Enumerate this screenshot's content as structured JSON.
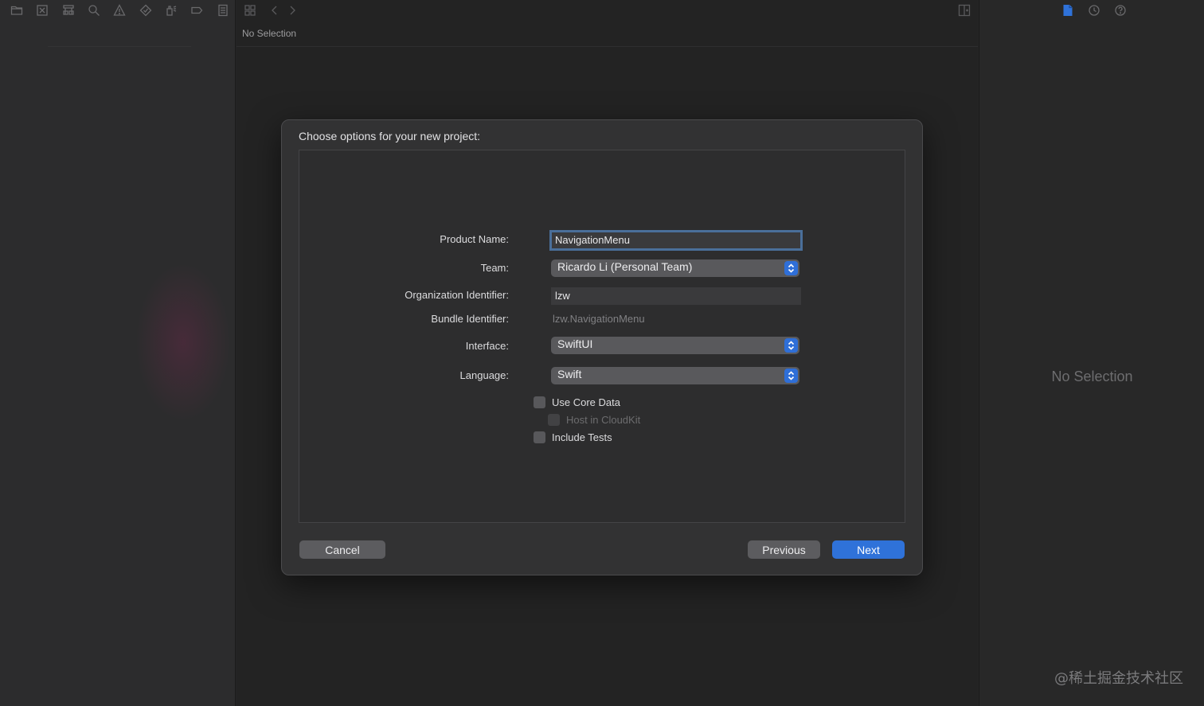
{
  "editor": {
    "jump_bar": "No Selection"
  },
  "inspector": {
    "empty_text": "No Selection"
  },
  "watermark": "@稀土掘金技术社区",
  "sheet": {
    "title": "Choose options for your new project:",
    "fields": {
      "product_name": {
        "label": "Product Name:",
        "value": "NavigationMenu"
      },
      "team": {
        "label": "Team:",
        "value": "Ricardo Li (Personal Team)"
      },
      "org_id": {
        "label": "Organization Identifier:",
        "value": "lzw"
      },
      "bundle_id": {
        "label": "Bundle Identifier:",
        "value": "lzw.NavigationMenu"
      },
      "interface": {
        "label": "Interface:",
        "value": "SwiftUI"
      },
      "language": {
        "label": "Language:",
        "value": "Swift"
      }
    },
    "checkboxes": {
      "core_data": "Use Core Data",
      "cloudkit": "Host in CloudKit",
      "tests": "Include Tests"
    },
    "buttons": {
      "cancel": "Cancel",
      "previous": "Previous",
      "next": "Next"
    }
  },
  "colors": {
    "accent": "#2f72d9",
    "focus_ring": "#4a6f9a",
    "inspector_active_icon": "#2f72d9"
  }
}
